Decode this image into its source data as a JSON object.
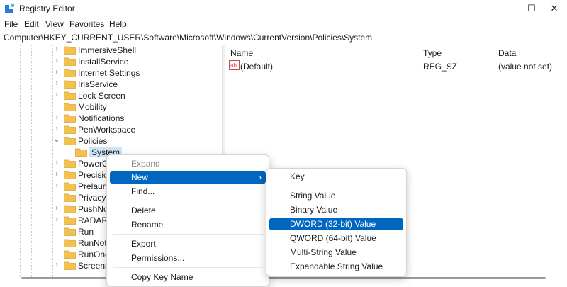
{
  "window": {
    "title": "Registry Editor",
    "controls": {
      "minimize": "—",
      "maximize": "☐",
      "close": "✕"
    }
  },
  "menubar": [
    "File",
    "Edit",
    "View",
    "Favorites",
    "Help"
  ],
  "address": "Computer\\HKEY_CURRENT_USER\\Software\\Microsoft\\Windows\\CurrentVersion\\Policies\\System",
  "tree": {
    "items": [
      {
        "label": "ImmersiveShell",
        "chevron": "›"
      },
      {
        "label": "InstallService",
        "chevron": "›"
      },
      {
        "label": "Internet Settings",
        "chevron": "›"
      },
      {
        "label": "IrisService",
        "chevron": "›"
      },
      {
        "label": "Lock Screen",
        "chevron": "›"
      },
      {
        "label": "Mobility",
        "chevron": ""
      },
      {
        "label": "Notifications",
        "chevron": "›"
      },
      {
        "label": "PenWorkspace",
        "chevron": "›"
      },
      {
        "label": "Policies",
        "chevron": "⌄"
      },
      {
        "label": "System",
        "chevron": "",
        "selected": true
      },
      {
        "label": "PowerCP",
        "chevron": "›"
      },
      {
        "label": "Precision",
        "chevron": "›"
      },
      {
        "label": "Prelaunc",
        "chevron": "›"
      },
      {
        "label": "Privacy",
        "chevron": ""
      },
      {
        "label": "PushNoti",
        "chevron": "›"
      },
      {
        "label": "RADAR",
        "chevron": "›"
      },
      {
        "label": "Run",
        "chevron": ""
      },
      {
        "label": "RunNotif",
        "chevron": ""
      },
      {
        "label": "RunOnce",
        "chevron": ""
      },
      {
        "label": "Screensa",
        "chevron": "›"
      }
    ]
  },
  "list": {
    "columns": [
      "Name",
      "Type",
      "Data"
    ],
    "rows": [
      {
        "name": "(Default)",
        "type": "REG_SZ",
        "data": "(value not set)",
        "icon": "string-value-icon"
      }
    ]
  },
  "context_menu": {
    "items": [
      {
        "label": "Expand",
        "disabled": true
      },
      {
        "label": "New",
        "highlighted": true,
        "submenu_arrow": "›"
      },
      {
        "label": "Find..."
      },
      {
        "label": "Delete"
      },
      {
        "label": "Rename"
      },
      {
        "label": "Export"
      },
      {
        "label": "Permissions..."
      },
      {
        "label": "Copy Key Name"
      }
    ]
  },
  "new_submenu": {
    "items": [
      {
        "label": "Key"
      },
      {
        "label": "String Value"
      },
      {
        "label": "Binary Value"
      },
      {
        "label": "DWORD (32-bit) Value",
        "highlighted": true
      },
      {
        "label": "QWORD (64-bit) Value"
      },
      {
        "label": "Multi-String Value"
      },
      {
        "label": "Expandable String Value"
      }
    ]
  },
  "colors": {
    "accent": "#0067c0",
    "selection": "#cce4f7",
    "folder": "#f2c14e"
  }
}
